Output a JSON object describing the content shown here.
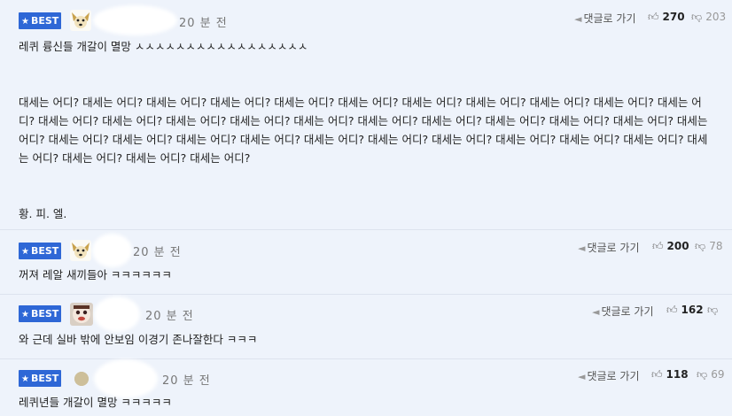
{
  "comments": [
    {
      "badge": "BEST",
      "avatar": "dog-face",
      "time": "20 분 전",
      "reply_label": "댓글로 가기",
      "upvotes": "270",
      "downvotes": "203",
      "text": "레퀴 륭신들 개갈이 멸망 ㅅㅅㅅㅅㅅㅅㅅㅅㅅㅅㅅㅅㅅㅅㅅㅅㅅ\n\n\n대세는 어디? 대세는 어디? 대세는 어디? 대세는 어디? 대세는 어디? 대세는 어디? 대세는 어디? 대세는 어디? 대세는 어디? 대세는 어디? 대세는 어디? 대세는 어디? 대세는 어디? 대세는 어디? 대세는 어디? 대세는 어디? 대세는 어디? 대세는 어디? 대세는 어디? 대세는 어디? 대세는 어디? 대세는 어디? 대세는 어디? 대세는 어디? 대세는 어디? 대세는 어디? 대세는 어디? 대세는 어디? 대세는 어디? 대세는 어디? 대세는 어디? 대세는 어디? 대세는 어디? 대세는 어디? 대세는 어디? 대세는 어디?\n\n\n황. 피. 엘."
    },
    {
      "badge": "BEST",
      "avatar": "dog-face",
      "time": "20 분 전",
      "reply_label": "댓글로 가기",
      "upvotes": "200",
      "downvotes": "78",
      "text": "꺼져 레알 새끼들아 ㅋㅋㅋㅋㅋㅋ"
    },
    {
      "badge": "BEST",
      "avatar": "cartoon-face",
      "time": "20 분 전",
      "reply_label": "댓글로 가기",
      "upvotes": "162",
      "downvotes": "",
      "text": "와 근데 실바 밖에 안보임 이경기 존나잘한다 ㅋㅋㅋ"
    },
    {
      "badge": "BEST",
      "avatar": "default-circle",
      "time": "20 분 전",
      "reply_label": "댓글로 가기",
      "upvotes": "118",
      "downvotes": "69",
      "text": "레퀴년들 개갈이 멸망 ㅋㅋㅋㅋㅋ"
    }
  ],
  "colors": {
    "badge": "#2e67d6",
    "background": "#eef3fb",
    "divider": "#dde3ee"
  }
}
